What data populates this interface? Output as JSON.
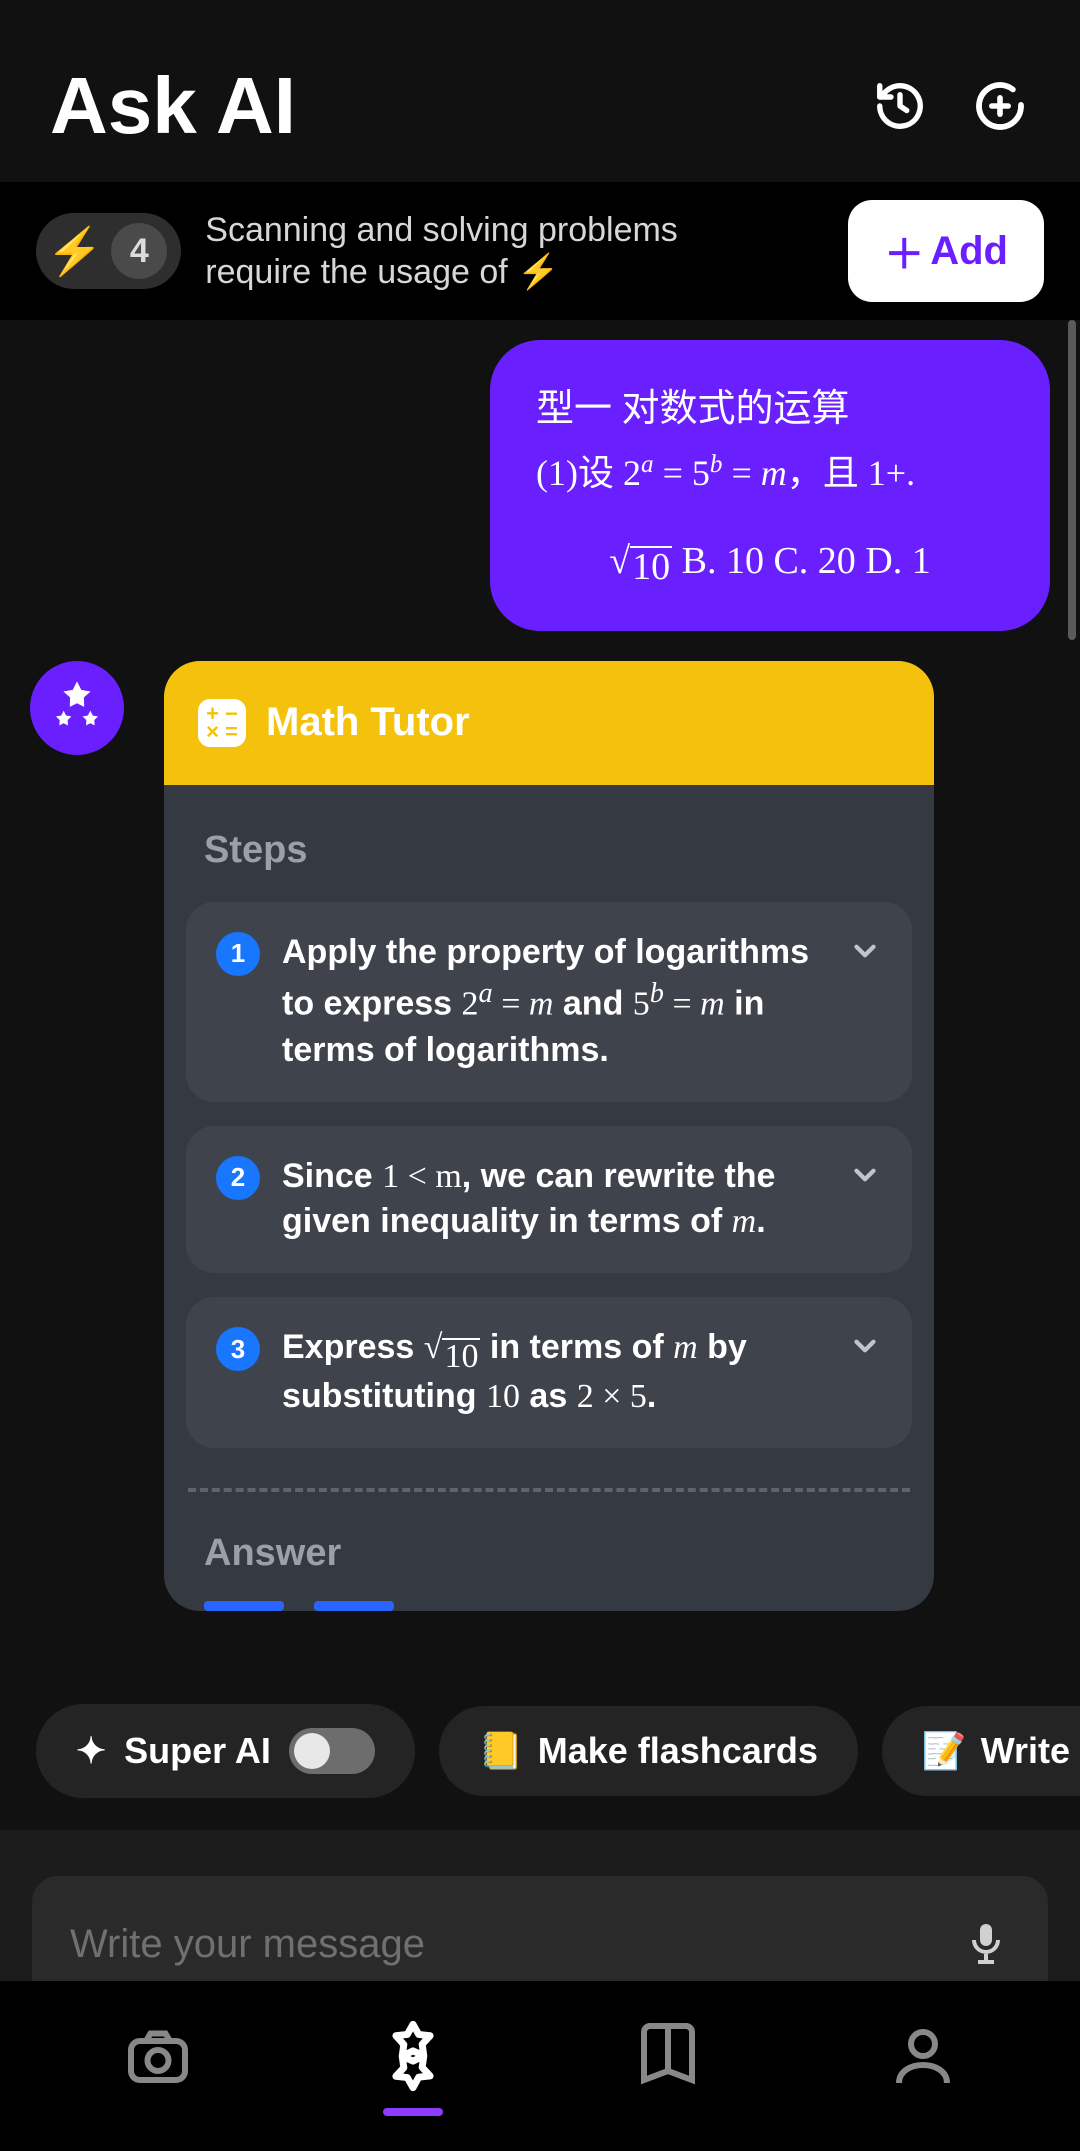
{
  "header": {
    "title": "Ask AI"
  },
  "credits": {
    "count": "4",
    "text_a": "Scanning and solving problems",
    "text_b": "require the usage of  ⚡",
    "add_label": "Add"
  },
  "user_message": {
    "line1": "型一 对数式的运算",
    "m1": "2",
    "m1e": "a",
    "eq": " = ",
    "m2": "5",
    "m2e": "b",
    "m3": "m",
    "tail": "，且 1+.",
    "ans_b": " B. 10 C. 20 D. 1"
  },
  "tutor": {
    "title": "Math Tutor",
    "steps_label": "Steps",
    "answer_label": "Answer",
    "steps": [
      {
        "n": "1",
        "pre": "Apply the property of logarithms to express ",
        "m1": "2",
        "m1e": "a",
        "mid1": " = ",
        "m2": "m",
        "mid2": " and ",
        "m3": "5",
        "m3e": "b",
        "mid3": " = ",
        "m4": "m",
        "post": " in terms of logarithms."
      },
      {
        "n": "2",
        "pre": "Since ",
        "m1": "1 < m",
        "post": ", we can rewrite the given inequality in terms of ",
        "m2": "m",
        "post2": "."
      },
      {
        "n": "3",
        "pre": "Express ",
        "sqrt": "10",
        "mid": " in terms of ",
        "m1": "m",
        "mid2": " by substituting ",
        "m2": "10",
        "mid3": " as ",
        "m3": "2 × 5",
        "post": "."
      }
    ]
  },
  "chips": {
    "super": "Super AI",
    "flash": "Make flashcards",
    "essay": "Write an essay"
  },
  "input": {
    "placeholder": "Write your message"
  }
}
